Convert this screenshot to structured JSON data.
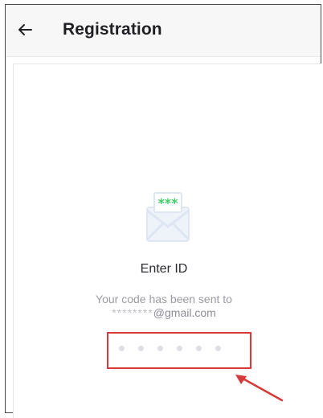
{
  "header": {
    "back_icon": "arrow-left-icon",
    "title": "Registration"
  },
  "main": {
    "icon": "envelope-icon",
    "envelope_code": "***",
    "heading": "Enter ID",
    "sent_line": "Your code has been sent to",
    "masked_email_prefix": "********",
    "email_domain": "@gmail.com",
    "code_digits": 6
  },
  "annotation": {
    "highlight_color": "#d63a3a",
    "arrow_icon": "arrow-up-left-icon"
  },
  "colors": {
    "accent_green": "#3fcf65",
    "envelope": "#dfe6f3"
  }
}
